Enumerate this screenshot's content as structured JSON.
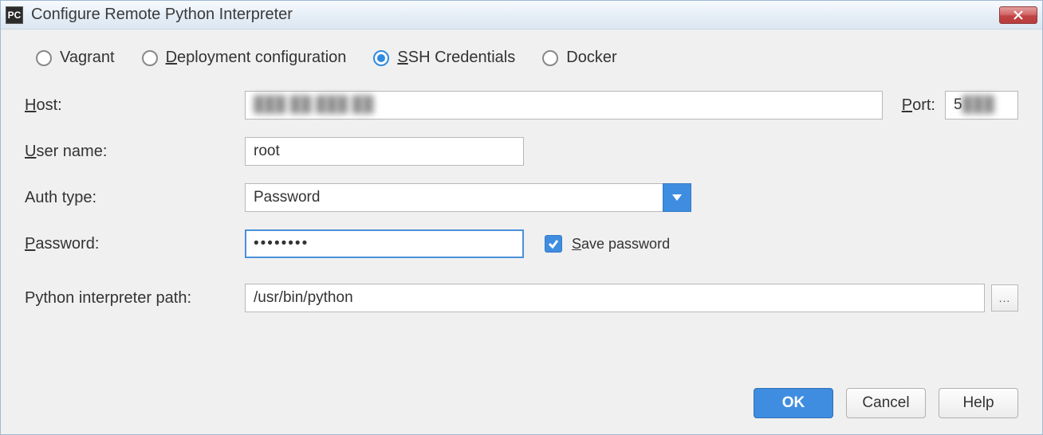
{
  "window": {
    "app_icon_text": "PC",
    "title": "Configure Remote Python Interpreter"
  },
  "radios": {
    "vagrant": "Vagrant",
    "deployment_pre": "D",
    "deployment_post": "eployment configuration",
    "ssh_pre": "S",
    "ssh_post": "SH Credentials",
    "docker": "Docker",
    "selected": "ssh"
  },
  "form": {
    "host_label_pre": "H",
    "host_label_post": "ost:",
    "host_value": "",
    "port_label_pre": "P",
    "port_label_post": "ort:",
    "port_value": "5",
    "user_label_pre": "U",
    "user_label_post": "ser name:",
    "user_value": "root",
    "auth_label": "Auth type:",
    "auth_value": "Password",
    "password_label_pre": "P",
    "password_label_post": "assword:",
    "password_value": "••••••••",
    "save_password_label_pre": "S",
    "save_password_label_post": "ave password",
    "save_password_checked": true,
    "interpreter_label": "Python interpreter path:",
    "interpreter_value": "/usr/bin/python",
    "ellipsis": "..."
  },
  "buttons": {
    "ok": "OK",
    "cancel": "Cancel",
    "help": "Help"
  }
}
